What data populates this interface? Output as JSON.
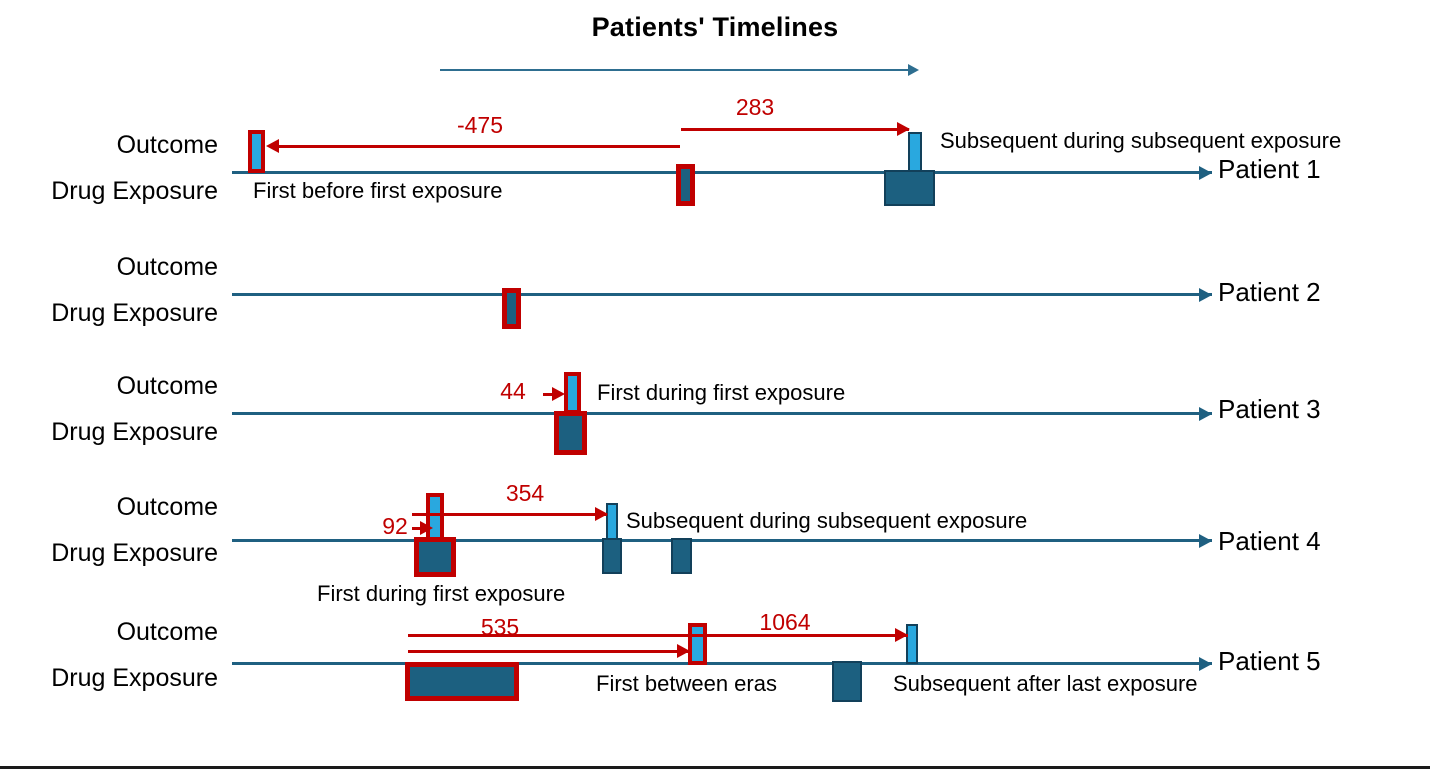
{
  "title": "Patients' Timelines",
  "row_labels": {
    "outcome": "Outcome",
    "exposure": "Drug Exposure"
  },
  "colors": {
    "axis": "#1F6081",
    "outcome_fill": "#29A8DF",
    "exposure_fill": "#1C6080",
    "highlight": "#C00000",
    "text": "#000000"
  },
  "patients": [
    {
      "label": "Patient 1",
      "values": [
        "-475",
        "283"
      ],
      "notes": [
        "First before first exposure",
        "Subsequent during subsequent exposure"
      ]
    },
    {
      "label": "Patient 2",
      "values": [],
      "notes": []
    },
    {
      "label": "Patient 3",
      "values": [
        "44"
      ],
      "notes": [
        "First during first exposure"
      ]
    },
    {
      "label": "Patient 4",
      "values": [
        "92",
        "354"
      ],
      "notes": [
        "Subsequent during subsequent exposure",
        "First during first exposure"
      ]
    },
    {
      "label": "Patient 5",
      "values": [
        "535",
        "1064"
      ],
      "notes": [
        "First between eras",
        "Subsequent after last exposure"
      ]
    }
  ]
}
